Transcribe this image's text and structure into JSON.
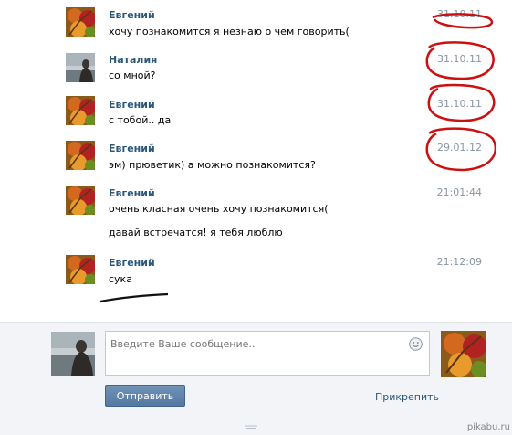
{
  "messages": [
    {
      "author": "Евгений",
      "time": "31.10.11",
      "lines": [
        "хочу познакомится я незнаю о чем говорить("
      ],
      "avatar": "autumn-leaves"
    },
    {
      "author": "Наталия",
      "time": "31.10.11",
      "lines": [
        "со мной?"
      ],
      "avatar": "woman-by-sea"
    },
    {
      "author": "Евгений",
      "time": "31.10.11",
      "lines": [
        "с тобой.. да"
      ],
      "avatar": "autumn-leaves"
    },
    {
      "author": "Евгений",
      "time": "29.01.12",
      "lines": [
        "эм) прюветик) а можно познакомится?"
      ],
      "avatar": "autumn-leaves"
    },
    {
      "author": "Евгений",
      "time": "21:01:44",
      "lines": [
        "очень класная очень хочу познакомится(",
        "давай встречатся! я тебя люблю"
      ],
      "avatar": "autumn-leaves"
    },
    {
      "author": "Евгений",
      "time": "21:12:09",
      "lines": [
        "сука"
      ],
      "avatar": "autumn-leaves"
    }
  ],
  "composer": {
    "placeholder": "Введите Ваше сообщение..",
    "send_label": "Отправить",
    "attach_label": "Прикрепить",
    "smile_icon": "smile-icon"
  },
  "annotation": {
    "ink_color": "#cc1010",
    "underline_color": "#111111"
  },
  "watermark": "pikabu.ru"
}
